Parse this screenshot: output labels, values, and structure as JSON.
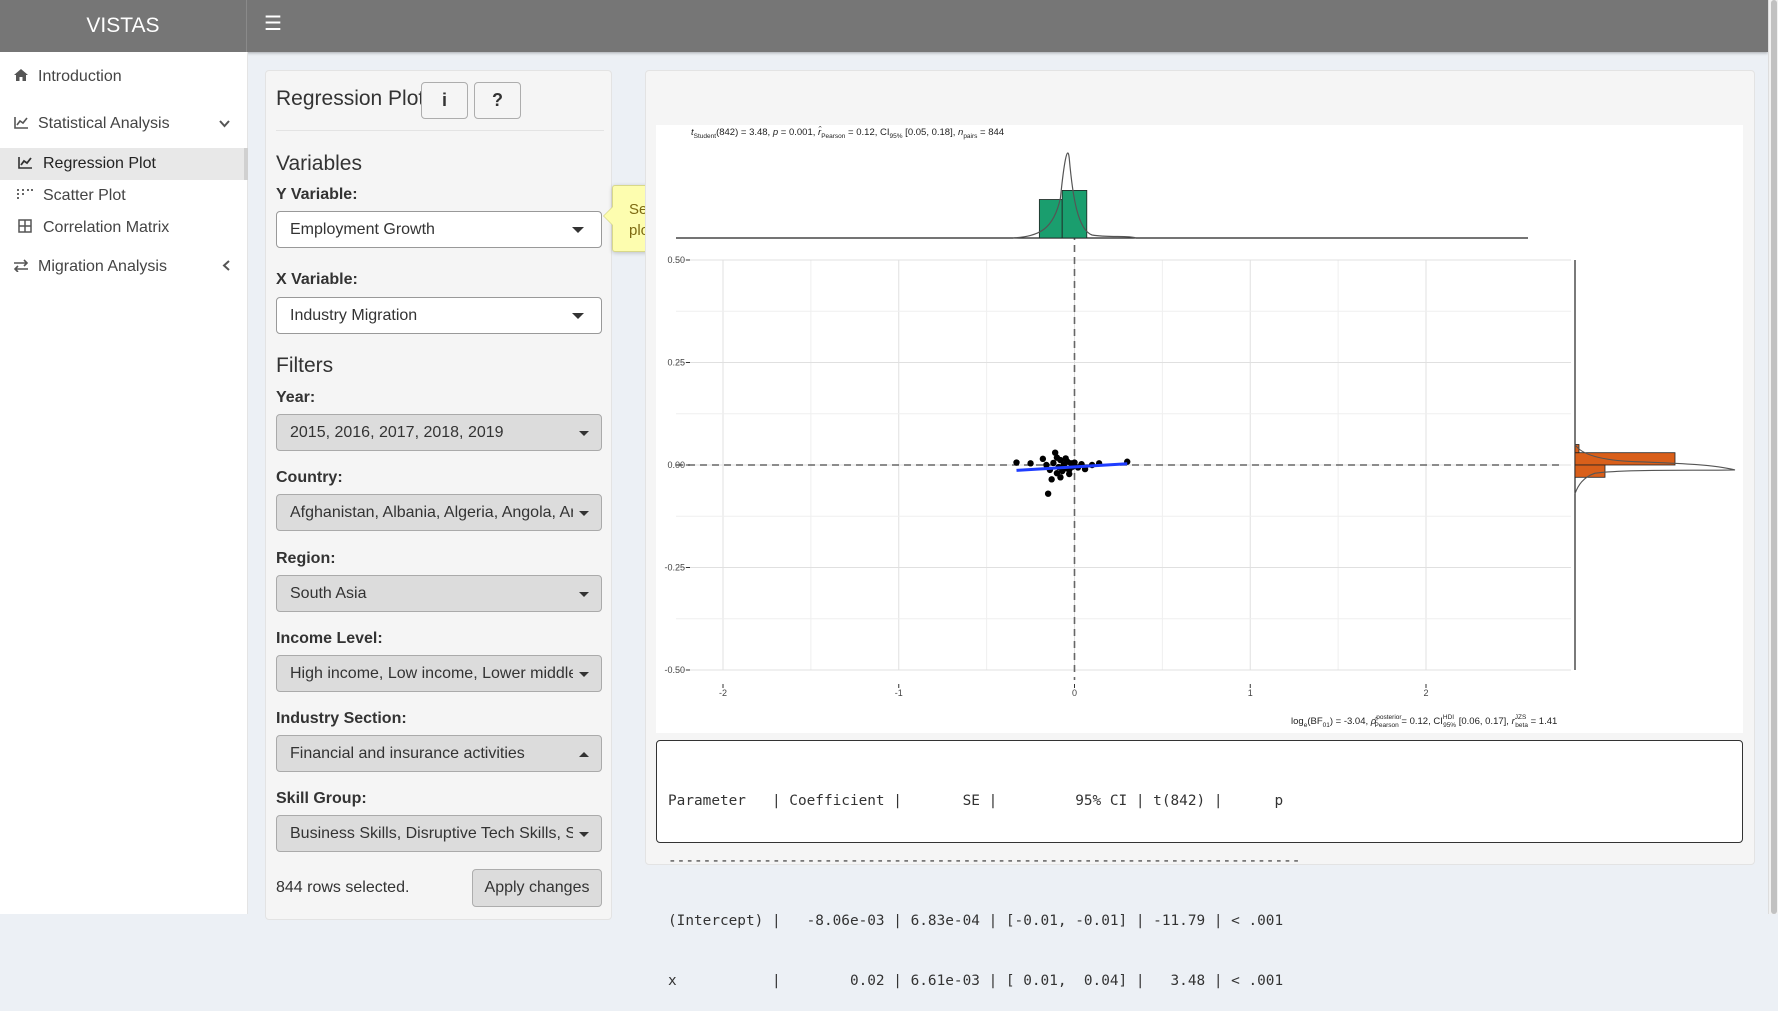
{
  "header": {
    "brand": "VISTAS",
    "menu_icon": "bars-icon"
  },
  "sidebar": {
    "items": [
      {
        "label": "Introduction",
        "icon": "home-icon"
      },
      {
        "label": "Statistical Analysis",
        "icon": "line-chart-icon",
        "chevron": "down"
      },
      {
        "label": "Regression Plot",
        "icon": "area-chart-icon",
        "active": true
      },
      {
        "label": "Scatter Plot",
        "icon": "scatter-dots-icon"
      },
      {
        "label": "Correlation Matrix",
        "icon": "grid-icon"
      },
      {
        "label": "Migration Analysis",
        "icon": "exchange-icon",
        "chevron": "left"
      }
    ]
  },
  "controls": {
    "title": "Regression Plot",
    "info_button": "i",
    "help_button": "?",
    "variables_heading": "Variables",
    "y_label": "Y Variable:",
    "y_value": "Employment Growth",
    "x_label": "X Variable:",
    "x_value": "Industry Migration",
    "filters_heading": "Filters",
    "year_label": "Year:",
    "year_value": "2015, 2016, 2017, 2018, 2019",
    "country_label": "Country:",
    "country_value": "Afghanistan, Albania, Algeria, Angola, Argentina",
    "region_label": "Region:",
    "region_value": "South Asia",
    "income_label": "Income Level:",
    "income_value": "High income, Low income, Lower middle income",
    "industry_label": "Industry Section:",
    "industry_value": "Financial and insurance activities",
    "skill_label": "Skill Group:",
    "skill_value": "Business Skills, Disruptive Tech Skills, Soft Skills",
    "rows_selected": "844 rows selected.",
    "apply_button": "Apply changes"
  },
  "tooltip": {
    "text": "Select variable for y axis of regression plot"
  },
  "plot": {
    "subtitle_parts": {
      "t": "t",
      "t_sub": "Student",
      "t_val": "(842) = 3.48, ",
      "p": "p",
      "p_val": " = 0.001, ",
      "r": "r̂",
      "r_sub": "Pearson",
      "r_val": " = 0.12, CI",
      "ci_sub": "95%",
      "ci_val": " [0.05, 0.18], ",
      "n": "n",
      "n_sub": "pairs",
      "n_val": " = 844"
    },
    "caption": "logₑ(BF₀₁) = -3.04, ρ̂ posterior Pearson = 0.12, CI HDI 95% [0.06, 0.17], r JZS beta = 1.41",
    "caption_parts": {
      "a": "log",
      "a_sub": "e",
      "b": "(BF",
      "b_sub": "01",
      "c": ") = -3.04, ",
      "rho": "ρ̂",
      "rho_sup": "posterior",
      "rho_sub": "Pearson",
      "d": " = 0.12, CI",
      "hdi_sup": "HDI",
      "hdi_sub": "95%",
      "e": " [0.06, 0.17], ",
      "rb": "r",
      "rb_sup": "JZS",
      "rb_sub": "beta",
      "f": " = 1.41"
    }
  },
  "chart_data": {
    "type": "scatter",
    "xlim": [
      -2.4,
      2.0
    ],
    "ylim": [
      -0.5,
      0.5
    ],
    "x_ticks": [
      "-2",
      "-1",
      "0",
      "1",
      "2"
    ],
    "x_tick_values": [
      -2,
      -1,
      0,
      1,
      2
    ],
    "y_ticks": [
      "0.50",
      "0.25",
      "0.00",
      "-0.25",
      "-0.50"
    ],
    "y_tick_values": [
      0.5,
      0.25,
      0.0,
      -0.25,
      -0.5
    ],
    "grid": true,
    "reference_lines": {
      "x": 0,
      "y": 0,
      "style": "dashed"
    },
    "regression_line": {
      "x": [
        -0.33,
        0.3
      ],
      "y": [
        -0.013,
        0.003
      ],
      "color": "#1f3dff"
    },
    "points": [
      {
        "x": -0.33,
        "y": 0.006
      },
      {
        "x": -0.25,
        "y": 0.004
      },
      {
        "x": -0.18,
        "y": 0.015
      },
      {
        "x": -0.16,
        "y": 0.0
      },
      {
        "x": -0.14,
        "y": -0.012
      },
      {
        "x": -0.12,
        "y": 0.005
      },
      {
        "x": -0.11,
        "y": 0.03
      },
      {
        "x": -0.1,
        "y": -0.02
      },
      {
        "x": -0.09,
        "y": -0.005
      },
      {
        "x": -0.08,
        "y": 0.012
      },
      {
        "x": -0.07,
        "y": -0.015
      },
      {
        "x": -0.06,
        "y": 0.002
      },
      {
        "x": -0.05,
        "y": -0.008
      },
      {
        "x": -0.04,
        "y": 0.008
      },
      {
        "x": -0.03,
        "y": -0.012
      },
      {
        "x": -0.02,
        "y": 0.004
      },
      {
        "x": -0.01,
        "y": -0.004
      },
      {
        "x": 0.0,
        "y": 0.006
      },
      {
        "x": 0.02,
        "y": -0.006
      },
      {
        "x": 0.04,
        "y": 0.002
      },
      {
        "x": 0.06,
        "y": -0.01
      },
      {
        "x": 0.1,
        "y": 0.0
      },
      {
        "x": 0.14,
        "y": 0.004
      },
      {
        "x": 0.3,
        "y": 0.008
      },
      {
        "x": -0.15,
        "y": -0.07
      },
      {
        "x": -0.13,
        "y": -0.035
      },
      {
        "x": -0.1,
        "y": 0.018
      },
      {
        "x": -0.08,
        "y": -0.03
      },
      {
        "x": -0.05,
        "y": 0.016
      },
      {
        "x": -0.03,
        "y": -0.022
      }
    ],
    "top_histogram": {
      "bins": [
        {
          "x0": -0.2,
          "x1": -0.07,
          "height": 0.55
        },
        {
          "x0": -0.07,
          "x1": 0.07,
          "height": 0.68
        }
      ],
      "color": "#1a9e6e"
    },
    "right_histogram": {
      "bins": [
        {
          "y0": 0.0,
          "y1": 0.03,
          "width": 0.5
        },
        {
          "y0": -0.03,
          "y1": 0.0,
          "width": 0.15
        },
        {
          "y0": 0.03,
          "y1": 0.05,
          "width": 0.02
        }
      ],
      "color": "#d95f1a"
    }
  },
  "stats_table": {
    "lines": [
      "Parameter   | Coefficient |       SE |         95% CI | t(842) |      p",
      "-------------------------------------------------------------------------",
      "(Intercept) |   -8.06e-03 | 6.83e-04 | [-0.01, -0.01] | -11.79 | < .001",
      "x           |        0.02 | 6.61e-03 | [ 0.01,  0.04] |   3.48 | < .001"
    ]
  },
  "colors": {
    "topbar": "#767676",
    "tooltip_bg": "#fdfdaf",
    "regression": "#1f3dff",
    "hist_top": "#1a9e6e",
    "hist_right": "#d95f1a"
  }
}
